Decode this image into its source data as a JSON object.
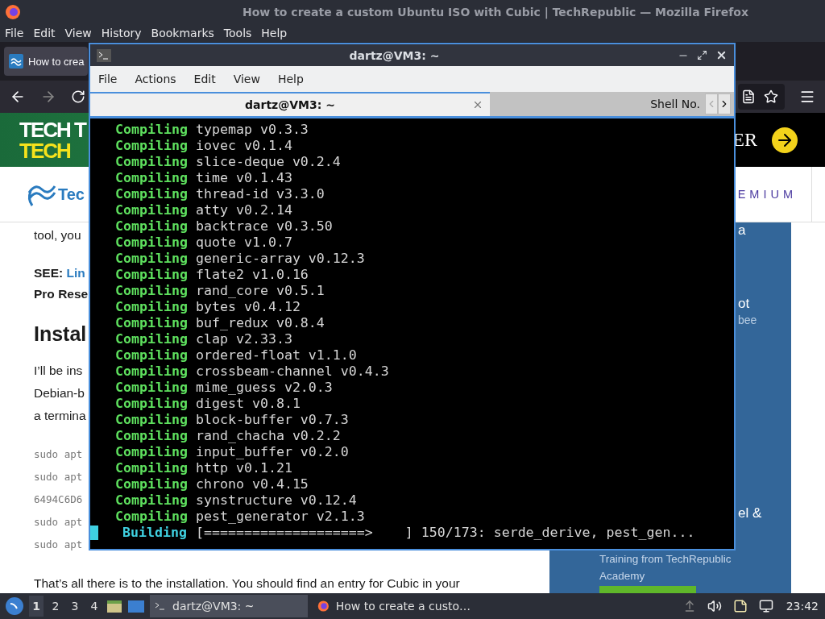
{
  "browser": {
    "title": "How to create a custom Ubuntu ISO with Cubic | TechRepublic — Mozilla Firefox",
    "menu": [
      "File",
      "Edit",
      "View",
      "History",
      "Bookmarks",
      "Tools",
      "Help"
    ],
    "tabs": [
      {
        "label": "How to crea",
        "selected": true
      }
    ],
    "banner": {
      "line_1": "TECH T",
      "line_2": "TECH",
      "right_text": "ER"
    },
    "site_header": {
      "logo": "Tec",
      "premium": "EMIUM"
    },
    "article": [
      {
        "kind": "text",
        "text": "tool, you"
      },
      {
        "kind": "see",
        "label": "SEE:",
        "link": "Lin"
      },
      {
        "kind": "bold",
        "text": "Pro Rese"
      },
      {
        "kind": "heading",
        "text": "Instal"
      },
      {
        "kind": "text",
        "text": "I’ll be ins"
      },
      {
        "kind": "text",
        "text": "Debian-b"
      },
      {
        "kind": "text",
        "text": "a termina"
      },
      {
        "kind": "code",
        "text": "sudo apt"
      },
      {
        "kind": "code",
        "text": "sudo apt"
      },
      {
        "kind": "code",
        "text": "6494C6D6"
      },
      {
        "kind": "code",
        "text": "sudo apt"
      },
      {
        "kind": "code",
        "text": "sudo apt"
      },
      {
        "kind": "text",
        "text": "That’s all there is to the installation. You should find an entry for Cubic in your"
      }
    ],
    "sidebar": [
      {
        "kind": "peek",
        "text": "a"
      },
      {
        "kind": "peek",
        "text": "ot"
      },
      {
        "kind": "peek_small",
        "text": "bee"
      },
      {
        "kind": "peek",
        "text": "el &"
      },
      {
        "kind": "promo",
        "text": "Training from TechRepublic"
      },
      {
        "kind": "promo",
        "text": "Academy"
      },
      {
        "kind": "button"
      }
    ]
  },
  "terminal": {
    "title": "dartz@VM3: ~",
    "menu": [
      "File",
      "Actions",
      "Edit",
      "View",
      "Help"
    ],
    "tabs": [
      {
        "label": "dartz@VM3: ~",
        "selected": true
      },
      {
        "label": "Shell No.",
        "selected": false
      }
    ],
    "lines": [
      {
        "verb": "Compiling",
        "text": "typemap v0.3.3"
      },
      {
        "verb": "Compiling",
        "text": "iovec v0.1.4"
      },
      {
        "verb": "Compiling",
        "text": "slice-deque v0.2.4"
      },
      {
        "verb": "Compiling",
        "text": "time v0.1.43"
      },
      {
        "verb": "Compiling",
        "text": "thread-id v3.3.0"
      },
      {
        "verb": "Compiling",
        "text": "atty v0.2.14"
      },
      {
        "verb": "Compiling",
        "text": "backtrace v0.3.50"
      },
      {
        "verb": "Compiling",
        "text": "quote v1.0.7"
      },
      {
        "verb": "Compiling",
        "text": "generic-array v0.12.3"
      },
      {
        "verb": "Compiling",
        "text": "flate2 v1.0.16"
      },
      {
        "verb": "Compiling",
        "text": "rand_core v0.5.1"
      },
      {
        "verb": "Compiling",
        "text": "bytes v0.4.12"
      },
      {
        "verb": "Compiling",
        "text": "buf_redux v0.8.4"
      },
      {
        "verb": "Compiling",
        "text": "clap v2.33.3"
      },
      {
        "verb": "Compiling",
        "text": "ordered-float v1.1.0"
      },
      {
        "verb": "Compiling",
        "text": "crossbeam-channel v0.4.3"
      },
      {
        "verb": "Compiling",
        "text": "mime_guess v2.0.3"
      },
      {
        "verb": "Compiling",
        "text": "digest v0.8.1"
      },
      {
        "verb": "Compiling",
        "text": "block-buffer v0.7.3"
      },
      {
        "verb": "Compiling",
        "text": "rand_chacha v0.2.2"
      },
      {
        "verb": "Compiling",
        "text": "input_buffer v0.2.0"
      },
      {
        "verb": "Compiling",
        "text": "http v0.1.21"
      },
      {
        "verb": "Compiling",
        "text": "chrono v0.4.15"
      },
      {
        "verb": "Compiling",
        "text": "synstructure v0.12.4"
      },
      {
        "verb": "Compiling",
        "text": "pest_generator v2.1.3"
      }
    ],
    "status": {
      "verb": "Building",
      "bar": "[====================>    ]",
      "text": "150/173: serde_derive, pest_gen..."
    }
  },
  "taskbar": {
    "workspaces": [
      {
        "label": "1",
        "selected": true
      },
      {
        "label": "2",
        "selected": false
      },
      {
        "label": "3",
        "selected": false
      },
      {
        "label": "4",
        "selected": false
      }
    ],
    "tasks": [
      {
        "kind": "terminal",
        "label": "dartz@VM3: ~",
        "selected": true
      },
      {
        "kind": "browser",
        "label": "How to create a custo…",
        "selected": false
      }
    ],
    "clock": "23:42"
  }
}
